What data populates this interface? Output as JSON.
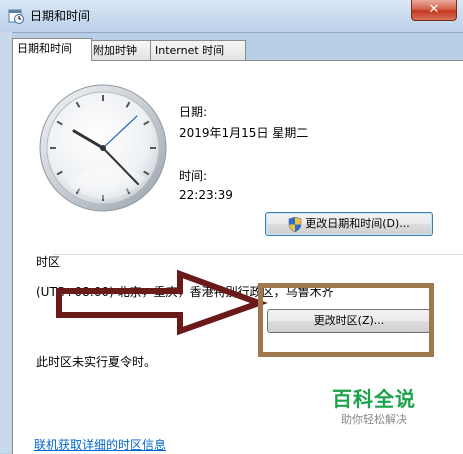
{
  "window": {
    "title": "日期和时间",
    "close_label": "✕"
  },
  "tabs": [
    {
      "label": "日期和时间",
      "active": true
    },
    {
      "label": "附加时钟",
      "active": false
    },
    {
      "label": "Internet 时间",
      "active": false
    }
  ],
  "date": {
    "label": "日期:",
    "value": "2019年1月15日 星期二"
  },
  "time": {
    "label": "时间:",
    "value": "22:23:39"
  },
  "change_datetime_button": "更改日期和时间(D)...",
  "timezone": {
    "section_label": "时区",
    "value": "(UTC+08:00) 北京，重庆，香港特别行政区，乌鲁木齐",
    "change_button": "更改时区(Z)...",
    "dst_note": "此时区未实行夏令时。"
  },
  "link": "联机获取详细的时区信息",
  "watermark": {
    "main": "百科全说",
    "sub": "助你轻松解决"
  },
  "colors": {
    "highlight": "#a07850",
    "arrow": "#6b1a1a",
    "watermark": "#1aa34a",
    "link": "#0066cc"
  },
  "icons": [
    "calendar-clock-icon",
    "uac-shield-icon",
    "close-icon"
  ]
}
